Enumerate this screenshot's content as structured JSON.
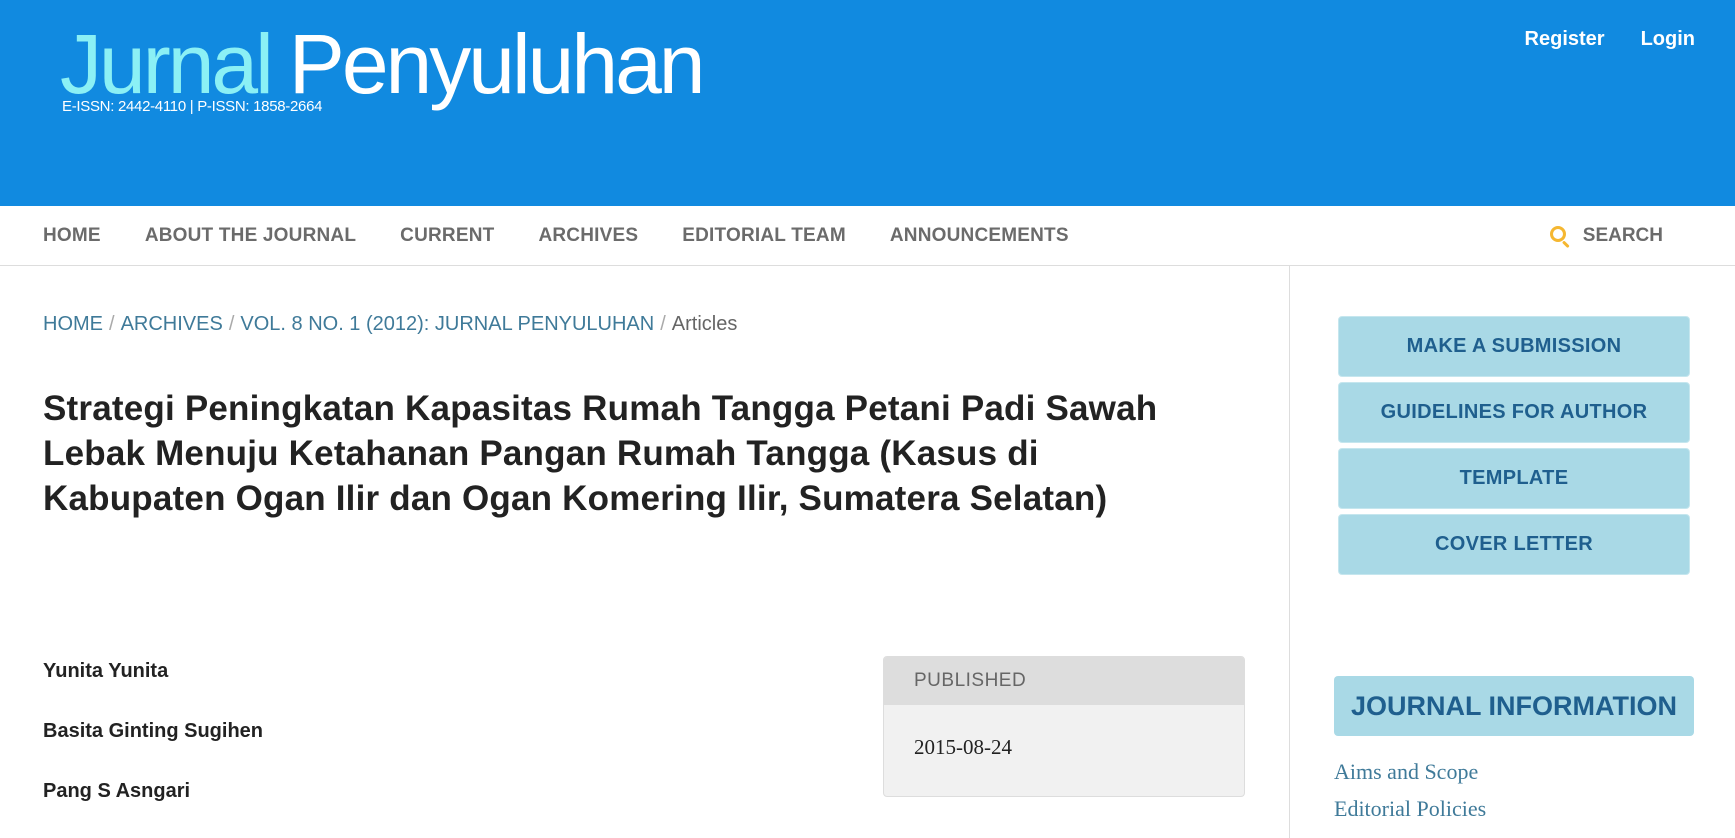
{
  "header": {
    "logo_word1": "Jurnal",
    "logo_word2": "Penyuluhan",
    "issn": "E-ISSN: 2442-4110 | P-ISSN: 1858-2664",
    "register": "Register",
    "login": "Login"
  },
  "nav": {
    "items": [
      "HOME",
      "ABOUT THE JOURNAL",
      "CURRENT",
      "ARCHIVES",
      "EDITORIAL TEAM",
      "ANNOUNCEMENTS"
    ],
    "search": "SEARCH"
  },
  "breadcrumb": {
    "home": "HOME",
    "archives": "ARCHIVES",
    "issue": "VOL. 8 NO. 1 (2012): JURNAL PENYULUHAN",
    "current": "Articles"
  },
  "article": {
    "title": "Strategi Peningkatan Kapasitas Rumah Tangga Petani Padi Sawah Lebak Menuju Ketahanan Pangan Rumah Tangga (Kasus di Kabupaten Ogan Ilir dan Ogan Komering Ilir, Sumatera Selatan)",
    "authors": [
      "Yunita Yunita",
      "Basita Ginting Sugihen",
      "Pang S Asngari"
    ],
    "published_label": "PUBLISHED",
    "published_date": "2015-08-24"
  },
  "sidebar": {
    "buttons": [
      "MAKE A SUBMISSION",
      "GUIDELINES FOR AUTHOR",
      "TEMPLATE",
      "COVER LETTER"
    ],
    "journal_info": "JOURNAL INFORMATION",
    "links": [
      "Aims and Scope",
      "Editorial Policies"
    ]
  },
  "colors": {
    "header_bg": "#118ae0",
    "logo_accent": "#8bf0f5",
    "sidebar_button_bg": "#a9d9e6",
    "sidebar_button_text": "#1f5f8e",
    "search_icon": "#f5b731"
  }
}
